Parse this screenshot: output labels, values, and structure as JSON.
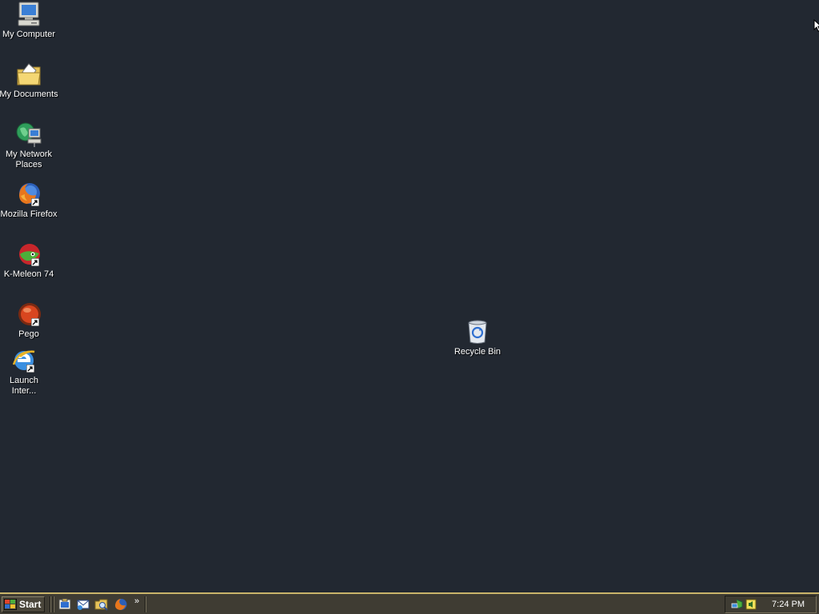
{
  "desktop": {
    "background_color": "#222831",
    "icons": [
      {
        "label": "My Computer",
        "icon": "my-computer-icon"
      },
      {
        "label": "My Documents",
        "icon": "my-documents-icon"
      },
      {
        "label": "My Network Places",
        "icon": "my-network-places-icon"
      },
      {
        "label": "Mozilla Firefox",
        "icon": "firefox-icon"
      },
      {
        "label": "K-Meleon 74",
        "icon": "k-meleon-icon"
      },
      {
        "label": "Pego",
        "icon": "pego-icon"
      },
      {
        "label": "Launch Inter...",
        "icon": "internet-explorer-icon"
      },
      {
        "label": "Recycle Bin",
        "icon": "recycle-bin-icon"
      }
    ]
  },
  "taskbar": {
    "start_label": "Start",
    "quick_launch": [
      "show-desktop-icon",
      "outlook-express-icon",
      "explorer-icon",
      "firefox-icon"
    ],
    "chevron": "»",
    "tray_icons": [
      "network-icon",
      "volume-icon"
    ],
    "clock": "7:24 PM",
    "border_color": "#c9b46a"
  }
}
